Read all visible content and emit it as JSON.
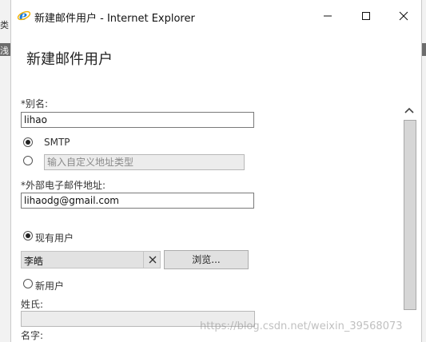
{
  "background": {
    "left_text": "类",
    "left_bar_text": "浅"
  },
  "window": {
    "title": "新建邮件用户 - Internet Explorer",
    "controls": [
      "minimize-icon",
      "maximize-icon",
      "close-icon"
    ]
  },
  "form": {
    "heading": "新建邮件用户",
    "alias_label": "*别名:",
    "alias_value": "lihao",
    "smtp_label": "SMTP",
    "custom_type_placeholder": "输入自定义地址类型",
    "external_email_label": "*外部电子邮件地址:",
    "external_email_value": "lihaodg@gmail.com",
    "existing_user_label": "现有用户",
    "existing_user_value": "李皓",
    "browse_label": "浏览...",
    "new_user_label": "新用户",
    "surname_label": "姓氏:",
    "surname_value": "",
    "given_name_label": "名字:"
  },
  "watermark": "https://blog.csdn.net/weixin_39568073",
  "colors": {
    "ie_blue": "#1e7bd6",
    "ie_ring": "#f1b100"
  }
}
